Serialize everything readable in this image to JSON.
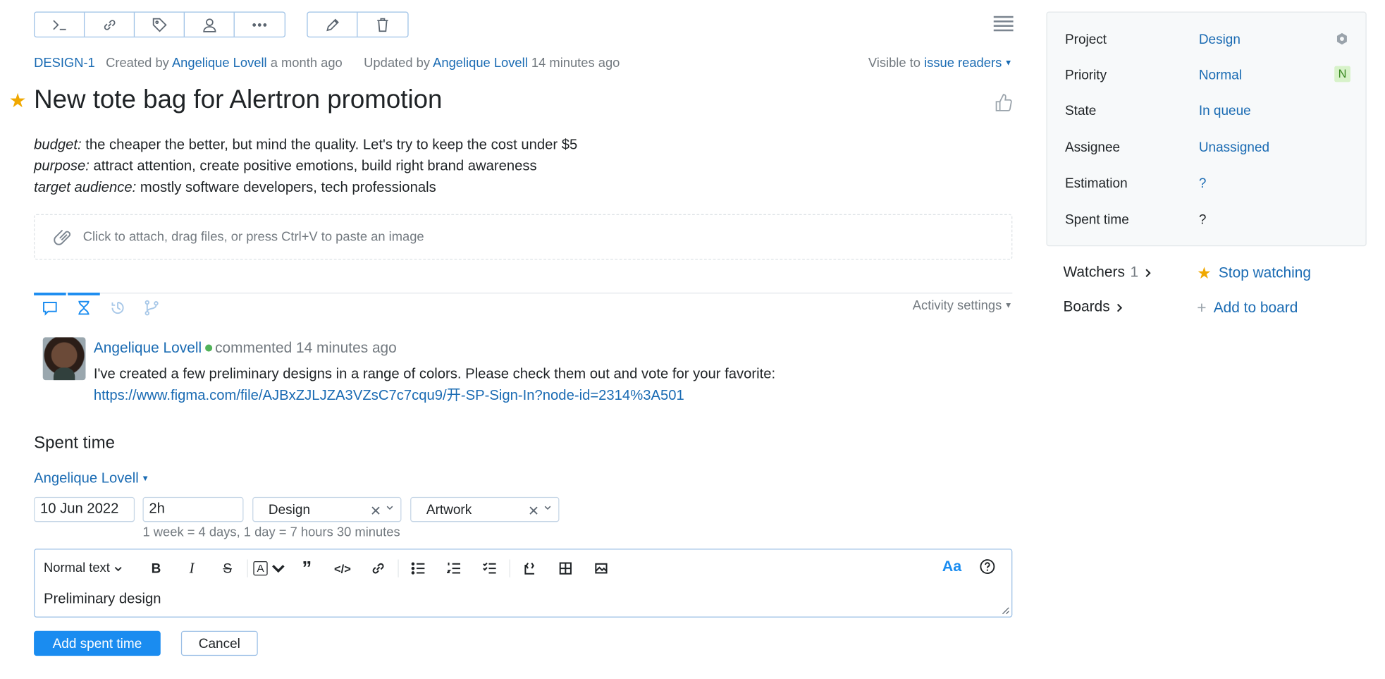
{
  "issue": {
    "id": "DESIGN-1",
    "created_prefix": "Created by",
    "author": "Angelique Lovell",
    "created_ago": "a month ago",
    "updated_prefix": "Updated by",
    "updater": "Angelique Lovell",
    "updated_ago": "14 minutes ago",
    "visible_prefix": "Visible to",
    "visible_to": "issue readers",
    "title": "New tote bag for Alertron promotion",
    "description": [
      {
        "key": "budget:",
        "text": " the cheaper the better, but mind the quality. Let's try to keep the cost under $5"
      },
      {
        "key": "purpose:",
        "text": " attract attention, create positive emotions, build right brand awareness"
      },
      {
        "key": "target audience:",
        "text": " mostly software developers, tech professionals"
      }
    ],
    "attach_hint": "Click to attach, drag files, or press Ctrl+V to paste an image"
  },
  "activity": {
    "settings_label": "Activity settings",
    "comment": {
      "author": "Angelique Lovell",
      "action": "commented 14 minutes ago",
      "text": "I've created a few preliminary designs in a range of colors. Please check them out and vote for your favorite:",
      "link": "https://www.figma.com/file/AJBxZJLJZA3VZsC7c7cqu9/开-SP-Sign-In?node-id=2314%3A501"
    }
  },
  "spent_time": {
    "title": "Spent time",
    "user": "Angelique Lovell",
    "date": "10 Jun 2022",
    "duration": "2h",
    "type": "Design",
    "category": "Artwork",
    "hint": "1 week = 4 days, 1 day = 7 hours 30 minutes",
    "editor": {
      "format": "Normal text",
      "aa_label": "Aa",
      "content": "Preliminary design"
    },
    "submit_label": "Add spent time",
    "cancel_label": "Cancel"
  },
  "sidebar": {
    "fields": [
      {
        "label": "Project",
        "value": "Design"
      },
      {
        "label": "Priority",
        "value": "Normal",
        "badge": "N"
      },
      {
        "label": "State",
        "value": "In queue"
      },
      {
        "label": "Assignee",
        "value": "Unassigned"
      },
      {
        "label": "Estimation",
        "value": "?"
      },
      {
        "label": "Spent time",
        "value": "?"
      }
    ],
    "watchers_label": "Watchers",
    "watchers_count": "1",
    "watch_action": "Stop watching",
    "boards_label": "Boards",
    "board_action": "Add to board"
  },
  "colors": {
    "accent": "#1a8cf0",
    "link": "#1a6bb3",
    "star": "#f0a800",
    "online": "#52b35a"
  },
  "icons": {
    "toolbar": [
      "command-icon",
      "link-icon",
      "tag-icon",
      "user-icon",
      "more-icon",
      "edit-icon",
      "delete-icon"
    ]
  }
}
